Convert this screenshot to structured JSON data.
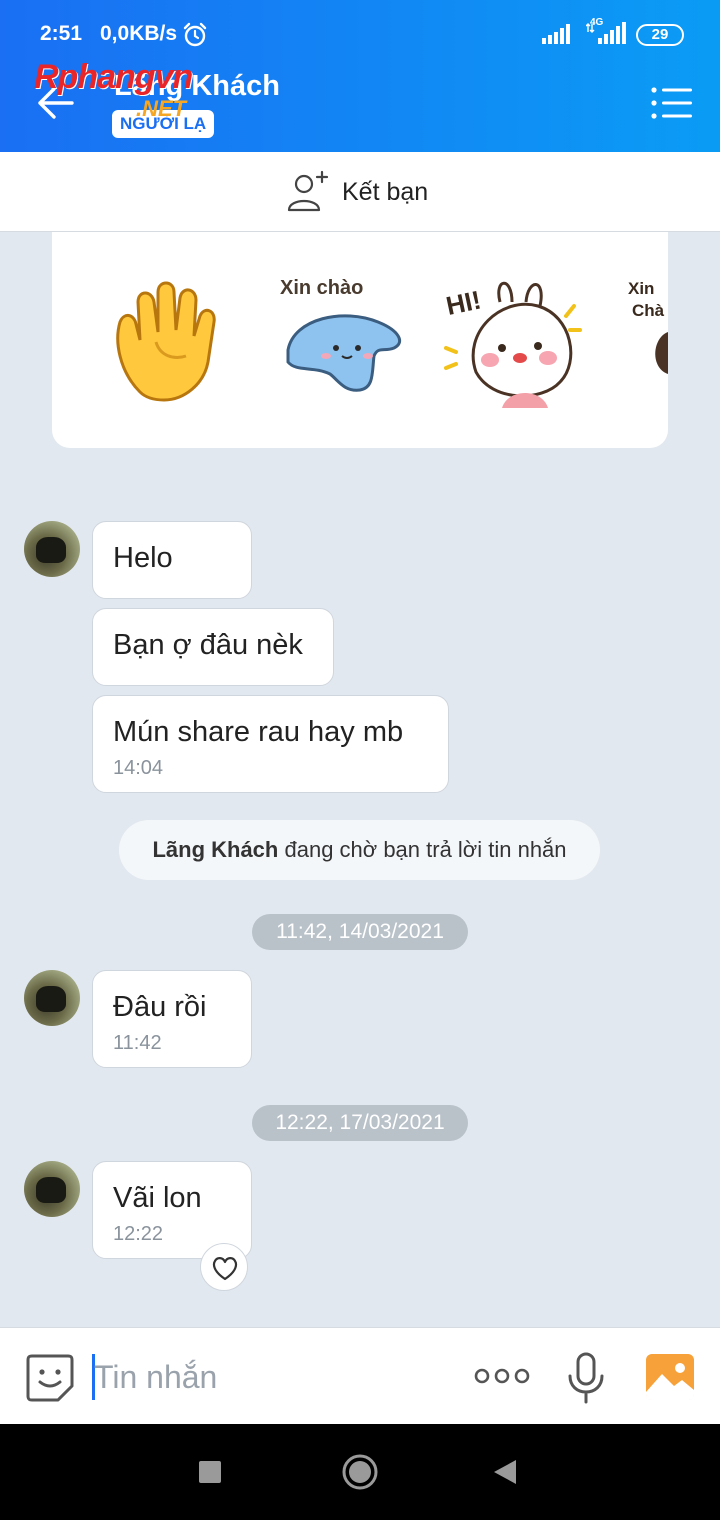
{
  "status_bar": {
    "time": "2:51",
    "speed": "0,0KB/s",
    "network": "4G",
    "battery": "29"
  },
  "header": {
    "contact_name": "Lãng Khách",
    "badge": "NGƯỜI LẠ",
    "watermark": "Rphangvn",
    "watermark_suffix": ".NET"
  },
  "add_friend": {
    "label": "Kết bạn"
  },
  "stickers": [
    "wave-hand",
    "xin-chao-whale",
    "hi-bunny",
    "xin-chao-partial"
  ],
  "messages": [
    {
      "text": "Helo"
    },
    {
      "text": "Bạn ợ đâu nèk"
    },
    {
      "text": "Mún share rau hay mb",
      "time": "14:04"
    }
  ],
  "notice": {
    "name": "Lãng Khách",
    "text": "đang chờ bạn trả lời tin nhắn"
  },
  "date_separators": [
    "11:42, 14/03/2021",
    "12:22, 17/03/2021"
  ],
  "messages_2": [
    {
      "text": "Đâu rồi",
      "time": "11:42"
    }
  ],
  "messages_3": [
    {
      "text": "Vãi lon",
      "time": "12:22"
    }
  ],
  "composer": {
    "placeholder": "Tin nhắn"
  },
  "colors": {
    "accent": "#1a6ff3",
    "header_end": "#0a9cf5",
    "bg": "#e2e8ef"
  }
}
